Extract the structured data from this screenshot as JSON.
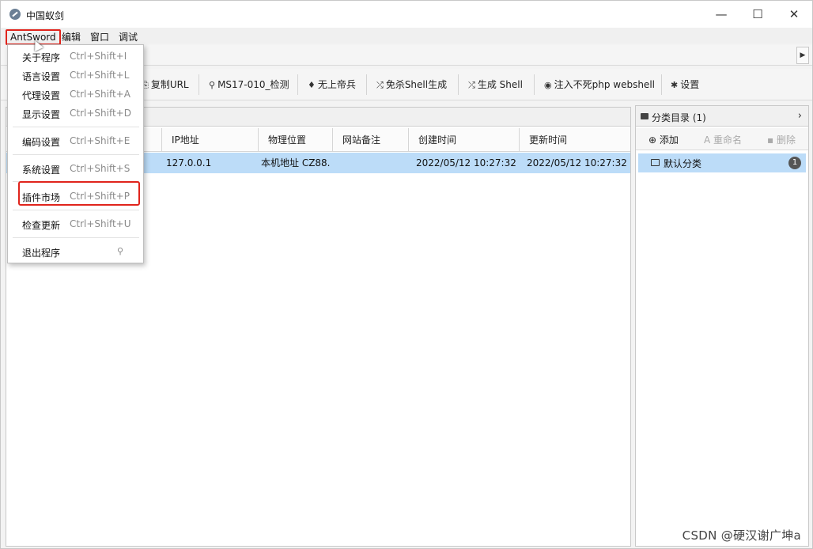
{
  "window": {
    "title": "中国蚁剑",
    "minimize": "—",
    "maximize": "☐",
    "close": "✕"
  },
  "menubar": {
    "items": [
      "AntSword",
      "编辑",
      "窗口",
      "调试"
    ]
  },
  "dropdown": {
    "items": [
      {
        "label": "关于程序",
        "shortcut": "Ctrl+Shift+I"
      },
      {
        "label": "语言设置",
        "shortcut": "Ctrl+Shift+L"
      },
      {
        "label": "代理设置",
        "shortcut": "Ctrl+Shift+A"
      },
      {
        "label": "显示设置",
        "shortcut": "Ctrl+Shift+D"
      },
      {
        "label": "编码设置",
        "shortcut": "Ctrl+Shift+E"
      },
      {
        "label": "系统设置",
        "shortcut": "Ctrl+Shift+S"
      },
      {
        "label": "插件市场",
        "shortcut": "Ctrl+Shift+P"
      },
      {
        "label": "检查更新",
        "shortcut": "Ctrl+Shift+U"
      },
      {
        "label": "退出程序",
        "shortcut": ""
      }
    ]
  },
  "toolbar": {
    "buttons": [
      {
        "label": "复制URL",
        "icon": "copy-icon"
      },
      {
        "label": "MS17-010_检测",
        "icon": "search-icon"
      },
      {
        "label": "无上帝兵",
        "icon": "sword-icon"
      },
      {
        "label": "免杀Shell生成",
        "icon": "shuffle-icon"
      },
      {
        "label": "生成 Shell",
        "icon": "shuffle-icon"
      },
      {
        "label": "注入不死php webshell",
        "icon": "eye-icon"
      },
      {
        "label": "设置",
        "icon": "gear-icon"
      }
    ]
  },
  "grid": {
    "columns": [
      "IP地址",
      "物理位置",
      "网站备注",
      "创建时间",
      "更新时间"
    ],
    "rows": [
      {
        "ip": "127.0.0.1",
        "location": "本机地址 CZ88.",
        "note": "",
        "created": "2022/05/12 10:27:32",
        "updated": "2022/05/12 10:27:32"
      }
    ]
  },
  "category": {
    "title": "分类目录 (1)",
    "add": "添加",
    "rename": "重命名",
    "delete": "删除",
    "items": [
      {
        "label": "默认分类",
        "count": "1"
      }
    ]
  },
  "watermark": "CSDN @硬汉谢广坤a"
}
